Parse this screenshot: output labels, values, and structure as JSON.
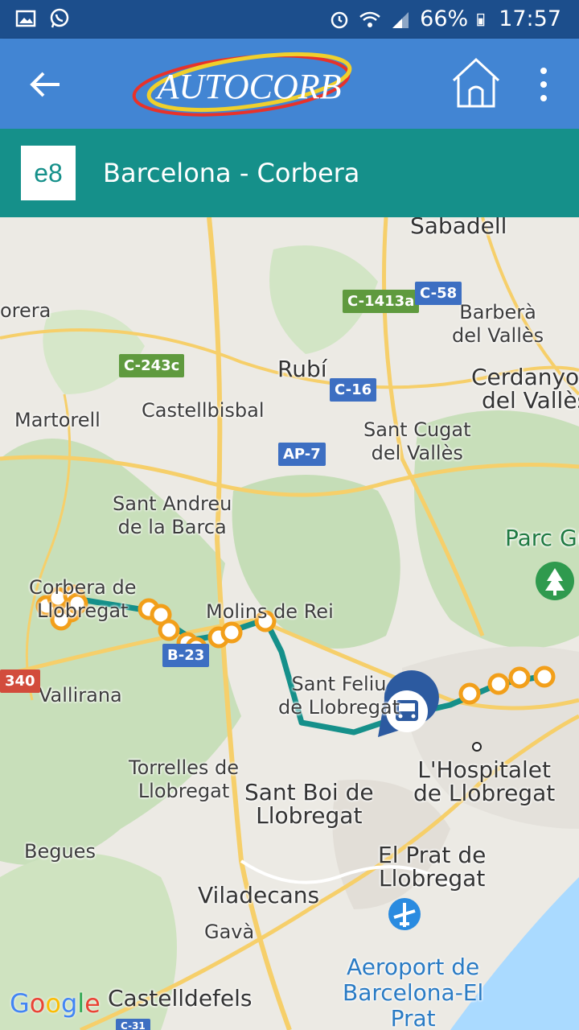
{
  "status_bar": {
    "battery": "66%",
    "time": "17:57"
  },
  "header": {
    "logo_text": "AUTOCORB",
    "brand_colors": {
      "bar": "#4285d3",
      "status": "#1c4e8c",
      "route": "#15908a"
    }
  },
  "route": {
    "code": "e8",
    "name": "Barcelona - Corbera"
  },
  "map": {
    "labels": {
      "sabadell": "Sabadell",
      "corbera_top": "orera",
      "barbera": "Barberà\ndel Vallès",
      "rubi": "Rubí",
      "cerdanyola": "Cerdanyola\ndel Vallès",
      "martorell": "Martorell",
      "castellbisbal": "Castellbisbal",
      "sant_cugat": "Sant Cugat\ndel Vallès",
      "sant_andreu": "Sant Andreu\nde la Barca",
      "parc": "Parc Gü",
      "corbera": "Corbera de\nLlobregat",
      "molins": "Molins de Rei",
      "vallirana": "Vallirana",
      "sant_feliu": "Sant Feliu\nde Llobregat",
      "hospitalet": "L'Hospitalet\nde Llobregat",
      "torrelles": "Torrelles de\nLlobregat",
      "sant_boi": "Sant Boi de\nLlobregat",
      "begues": "Begues",
      "el_prat": "El Prat de\nLlobregat",
      "viladecans": "Viladecans",
      "gava": "Gavà",
      "aeroport": "Aeroport de\nBarcelona-El\nPrat",
      "castelldefels": "Castelldefels",
      "google": "Google"
    },
    "roads": {
      "c1413a": "C-1413a",
      "c58": "C-58",
      "c243c": "C-243c",
      "c16": "C-16",
      "ap7": "AP-7",
      "b23": "B-23",
      "n340": "340",
      "c31": "C-31"
    },
    "icons": [
      "park-icon",
      "airport-icon",
      "bus-marker-icon"
    ]
  }
}
